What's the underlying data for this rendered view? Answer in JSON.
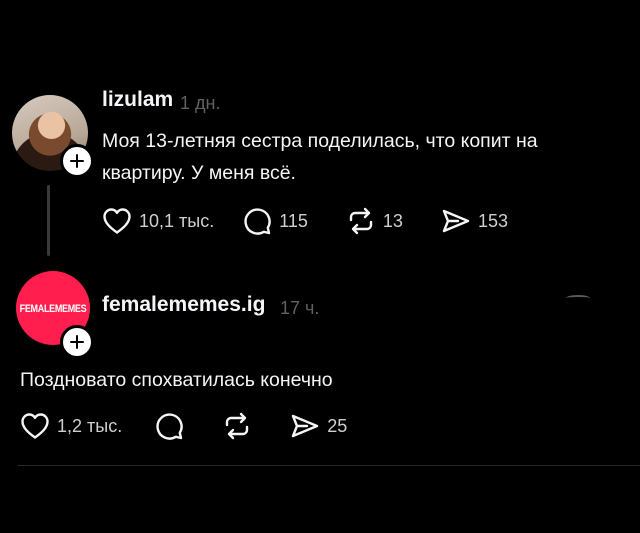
{
  "posts": [
    {
      "username": "lizulam",
      "time": "1 дн.",
      "text_line1": "Моя 13-летняя сестра поделилась, что копит на",
      "text_line2": "квартиру. У меня всё.",
      "likes": "10,1 тыс.",
      "comments": "115",
      "reposts": "13",
      "shares": "153"
    },
    {
      "username": "femalememes.ig",
      "avatar_text": "FEMALEMEMES",
      "time": "17 ч.",
      "text": "Поздновато спохватилась конечно",
      "likes": "1,2 тыс.",
      "shares": "25"
    }
  ],
  "icons": [
    "heart-icon",
    "comment-icon",
    "repost-icon",
    "share-icon",
    "plus-icon"
  ],
  "colors": {
    "background": "#000000",
    "text": "#f3f5f7",
    "muted": "#616161",
    "avatar_brand": "#ff1e4e"
  }
}
